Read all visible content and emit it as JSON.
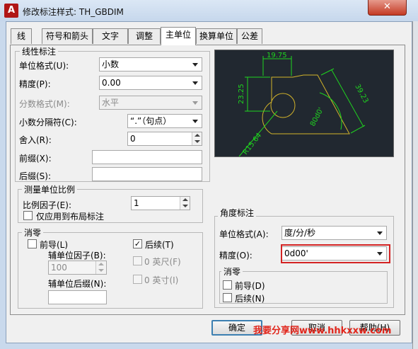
{
  "window": {
    "title": "修改标注样式: TH_GBDIM",
    "close": "✕"
  },
  "tabs": [
    "线",
    "符号和箭头",
    "文字",
    "调整",
    "主单位",
    "换算单位",
    "公差"
  ],
  "linear": {
    "title": "线性标注",
    "unit_format": {
      "label": "单位格式(U):",
      "value": "小数"
    },
    "precision": {
      "label": "精度(P):",
      "value": "0.00"
    },
    "fraction": {
      "label": "分数格式(M):",
      "value": "水平"
    },
    "decimal_sep": {
      "label": "小数分隔符(C):",
      "value": "“.”（句点）"
    },
    "round": {
      "label": "舍入(R):",
      "value": "0"
    },
    "prefix": {
      "label": "前缀(X):",
      "value": ""
    },
    "suffix": {
      "label": "后缀(S):",
      "value": ""
    }
  },
  "scale": {
    "title": "测量单位比例",
    "factor": {
      "label": "比例因子(E):",
      "value": "1"
    },
    "layout_only": {
      "label": "仅应用到布局标注",
      "checked": false
    }
  },
  "zero": {
    "title": "消零",
    "leading": {
      "label": "前导(L)",
      "checked": false
    },
    "trailing": {
      "label": "后续(T)",
      "checked": true,
      "mark": "✓"
    },
    "sub_factor": {
      "label": "辅单位因子(B):",
      "value": "100"
    },
    "sub_suffix": {
      "label": "辅单位后缀(N):",
      "value": ""
    },
    "feet": {
      "label": "0 英尺(F)"
    },
    "inches": {
      "label": "0 英寸(I)"
    }
  },
  "preview": {
    "dim_top": "19.75",
    "dim_left": "23.25",
    "dim_slant": "39.23",
    "angle": "80d0'",
    "radius": "R15.64"
  },
  "angular": {
    "title": "角度标注",
    "unit_format": {
      "label": "单位格式(A):",
      "value": "度/分/秒"
    },
    "precision": {
      "label": "精度(O):",
      "value": "0d00'"
    },
    "zero_title": "消零",
    "leading": {
      "label": "前导(D)"
    },
    "trailing": {
      "label": "后续(N)"
    }
  },
  "buttons": {
    "ok": "确定",
    "cancel": "取消",
    "help": "帮助(H)"
  },
  "watermark": "我要分享网www.hhkxxw.com",
  "colors": {
    "preview_bg": "#212830",
    "dim_line": "#1fd51f",
    "geometry": "#d2b32a",
    "highlight": "#d32323"
  }
}
